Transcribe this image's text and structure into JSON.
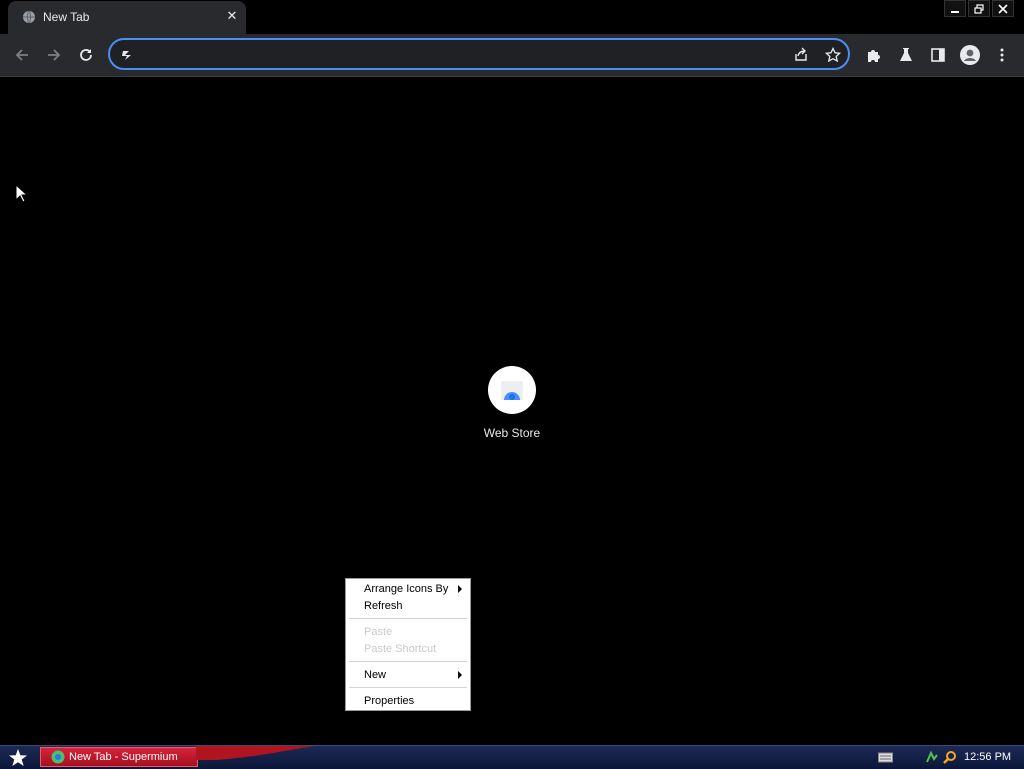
{
  "browser": {
    "tab": {
      "title": "New Tab"
    },
    "omnibox": {
      "value": "",
      "placeholder": ""
    }
  },
  "content": {
    "shortcuts": [
      {
        "label": "Web Store"
      }
    ]
  },
  "context_menu": {
    "items": [
      {
        "label": "Arrange Icons By",
        "disabled": false,
        "submenu": true
      },
      {
        "label": "Refresh",
        "disabled": false,
        "submenu": false
      },
      {
        "label": "Paste",
        "disabled": true,
        "submenu": false
      },
      {
        "label": "Paste Shortcut",
        "disabled": true,
        "submenu": false
      },
      {
        "label": "New",
        "disabled": false,
        "submenu": true
      },
      {
        "label": "Properties",
        "disabled": false,
        "submenu": false
      }
    ]
  },
  "taskbar": {
    "window_button": {
      "label": "New Tab - Supermium"
    },
    "clock": "12:56 PM"
  },
  "colors": {
    "accent": "#4c8df6",
    "toolbar": "#292a2d",
    "taskbar_button": "#c8182c"
  }
}
